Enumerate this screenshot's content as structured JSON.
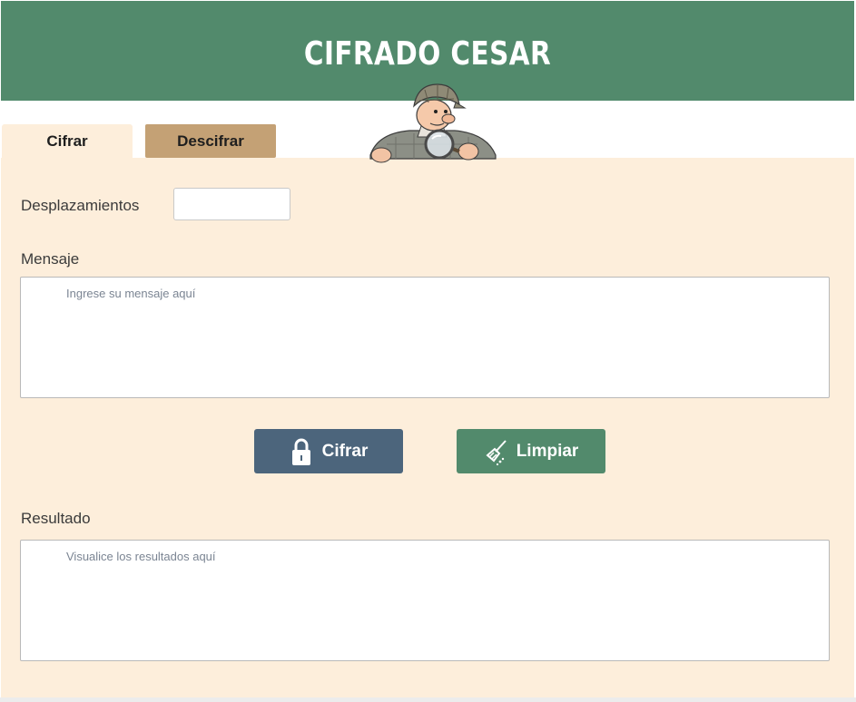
{
  "header": {
    "title": "CIFRADO CESAR"
  },
  "tabs": [
    {
      "label": "Cifrar",
      "active": true
    },
    {
      "label": "Descifrar",
      "active": false
    }
  ],
  "form": {
    "shift_label": "Desplazamientos",
    "shift_value": "",
    "message_label": "Mensaje",
    "message_placeholder": "Ingrese su mensaje aquí",
    "result_label": "Resultado",
    "result_placeholder": "Visualice los resultados aquí"
  },
  "buttons": {
    "encrypt_label": "Cifrar",
    "encrypt_icon": "lock-icon",
    "clear_label": "Limpiar",
    "clear_icon": "broom-icon"
  },
  "colors": {
    "header": "#528a6c",
    "panel": "#fdeedb",
    "tab_inactive": "#c4a175",
    "encrypt_button": "#4c657c",
    "clear_button": "#528a6c"
  }
}
